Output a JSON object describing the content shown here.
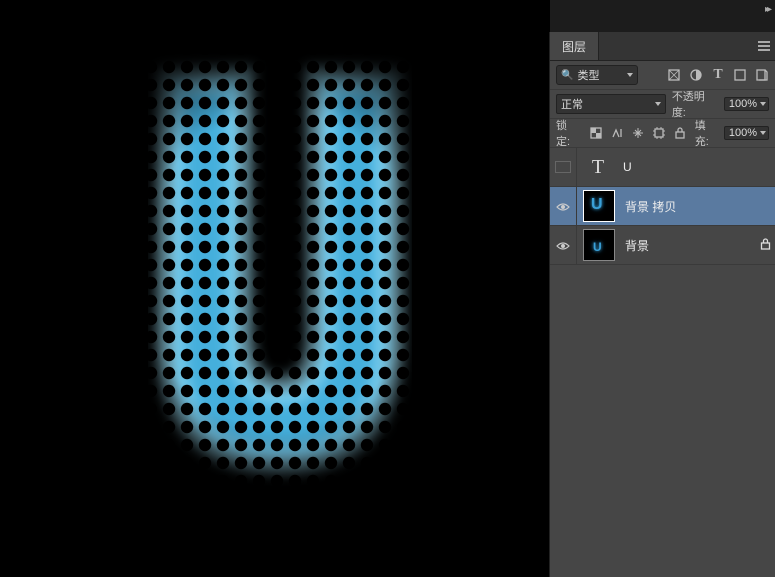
{
  "panel": {
    "tab_label": "图层",
    "filter": {
      "kind_label": "类型"
    },
    "blend": {
      "mode": "正常",
      "opacity_label": "不透明度:",
      "opacity_value": "100%"
    },
    "lock": {
      "label": "锁定:",
      "fill_label": "填充:",
      "fill_value": "100%"
    }
  },
  "layers": [
    {
      "name": "U",
      "type": "text",
      "visible": false,
      "selected": false,
      "locked": false
    },
    {
      "name": "背景 拷贝",
      "type": "raster",
      "visible": true,
      "selected": true,
      "locked": false
    },
    {
      "name": "背景",
      "type": "raster",
      "visible": true,
      "selected": false,
      "locked": true
    }
  ]
}
